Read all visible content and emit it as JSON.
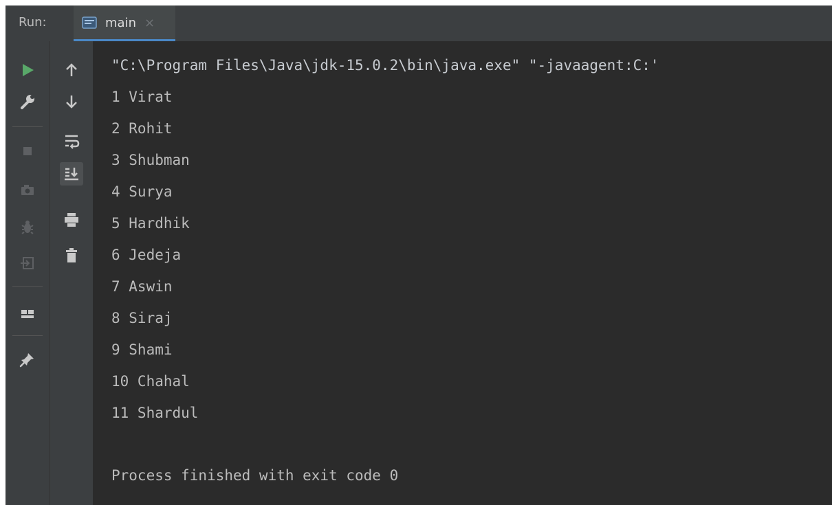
{
  "toolwindow": {
    "run_label": "Run:",
    "tab_label": "main",
    "tab_close": "×"
  },
  "colors": {
    "background": "#2b2b2b",
    "toolbar": "#3c3f41",
    "text": "#bbbbbb",
    "run_green": "#59a869",
    "tab_accent": "#4a88c7"
  },
  "left_toolbar": [
    "run-icon",
    "wrench-icon",
    "stop-icon",
    "camera-icon",
    "debug-icon",
    "exit-icon",
    "layout-icon",
    "pin-icon"
  ],
  "secondary_toolbar": [
    "arrow-up-icon",
    "arrow-down-icon",
    "soft-wrap-icon",
    "scroll-to-end-icon",
    "print-icon",
    "trash-icon"
  ],
  "console": {
    "command": "\"C:\\Program Files\\Java\\jdk-15.0.2\\bin\\java.exe\" \"-javaagent:C:'",
    "output": [
      "1 Virat",
      "2 Rohit",
      "3 Shubman",
      "4 Surya",
      "5 Hardhik",
      "6 Jedeja",
      "7 Aswin",
      "8 Siraj",
      "9 Shami",
      "10 Chahal",
      "11 Shardul"
    ],
    "exit_message": "Process finished with exit code 0"
  }
}
